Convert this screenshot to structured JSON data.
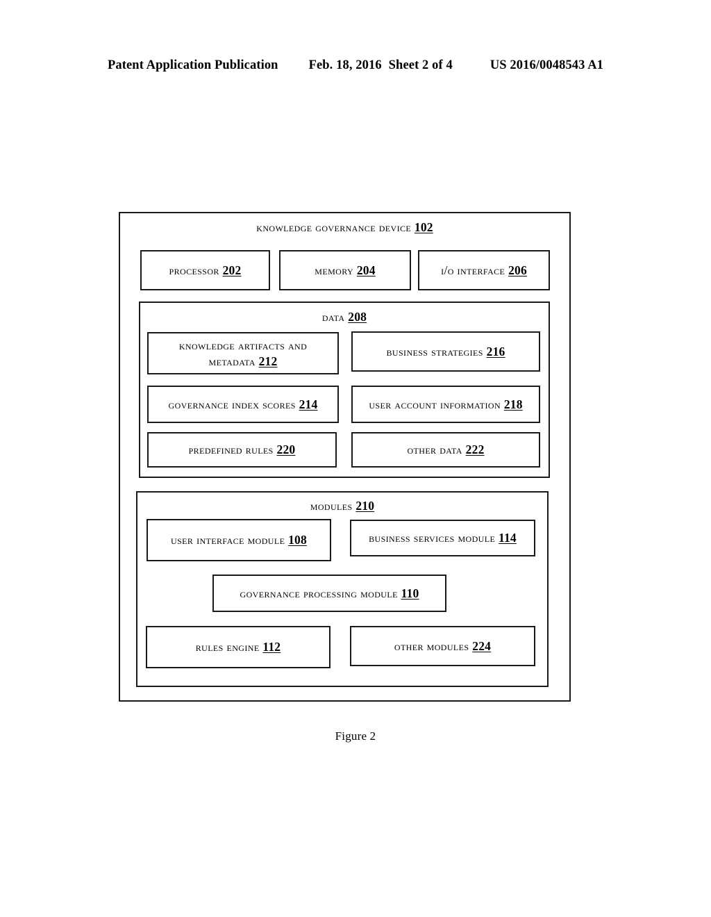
{
  "header": {
    "publication": "Patent Application Publication",
    "date": "Feb. 18, 2016",
    "sheet": "Sheet 2 of 4",
    "patent_number": "US 2016/0048543 A1"
  },
  "figure": {
    "caption": "Figure 2"
  },
  "diagram": {
    "device": {
      "title_text": "Knowledge Governance Device",
      "title_ref": "102"
    },
    "top_row": [
      {
        "text": "Processor",
        "ref": "202"
      },
      {
        "text": "Memory",
        "ref": "204"
      },
      {
        "text": "I/O Interface",
        "ref": "206"
      }
    ],
    "data_section": {
      "title_text": "Data",
      "title_ref": "208",
      "left_column": [
        {
          "line1": "Knowledge Artifacts and",
          "line2": "Metadata",
          "ref": "212"
        },
        {
          "line1": "Governance Index Scores",
          "line2": "",
          "ref": "214"
        },
        {
          "line1": "Predefined Rules",
          "line2": "",
          "ref": "220"
        }
      ],
      "right_column": [
        {
          "line1": "Business Strategies",
          "line2": "",
          "ref": "216"
        },
        {
          "line1": "User Account Information",
          "line2": "",
          "ref": "218"
        },
        {
          "line1": "Other Data",
          "line2": "",
          "ref": "222"
        }
      ]
    },
    "modules_section": {
      "title_text": "Modules",
      "title_ref": "210",
      "items": [
        {
          "text": "User Interface Module",
          "ref": "108"
        },
        {
          "text": "Business Services Module",
          "ref": "114"
        },
        {
          "text": "Governance Processing Module",
          "ref": "110"
        },
        {
          "text": "Rules Engine",
          "ref": "112"
        },
        {
          "text": "Other Modules",
          "ref": "224"
        }
      ]
    }
  },
  "colors": {
    "line": "#1a1a1a",
    "background": "#ffffff",
    "text": "#000000"
  }
}
